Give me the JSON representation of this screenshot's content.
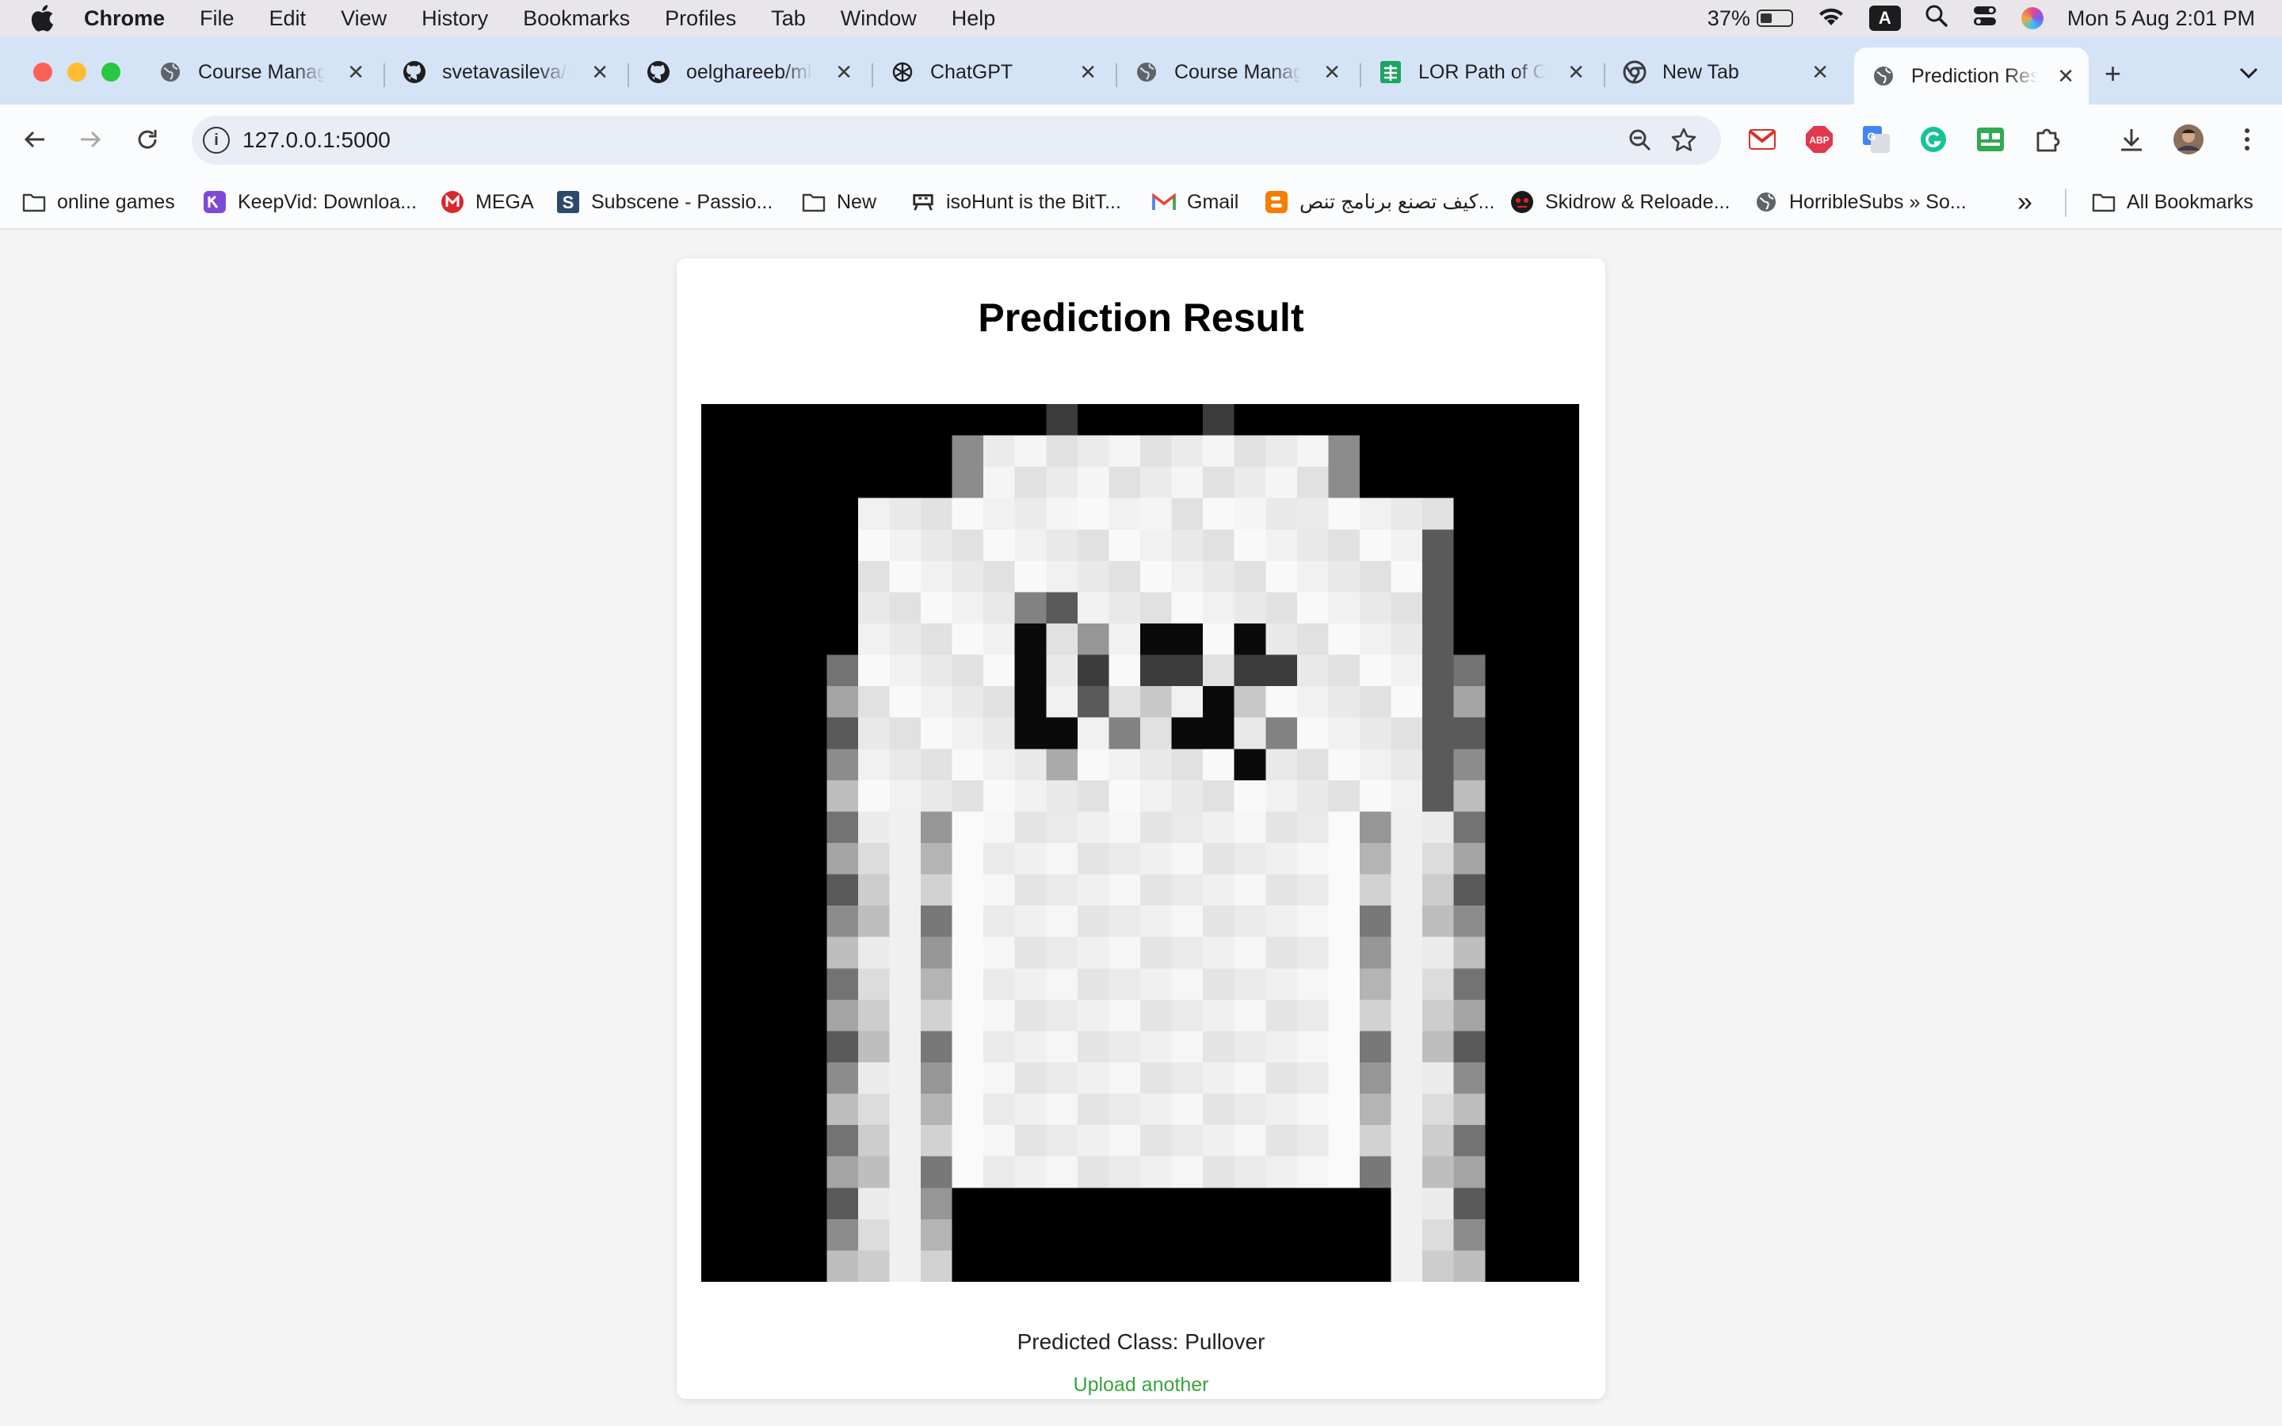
{
  "menubar": {
    "app_name": "Chrome",
    "items": [
      "File",
      "Edit",
      "View",
      "History",
      "Bookmarks",
      "Profiles",
      "Tab",
      "Window",
      "Help"
    ],
    "battery_percent": "37%",
    "battery_level": 0.37,
    "keyboard_input": "A",
    "datetime": "Mon 5 Aug  2:01 PM"
  },
  "tabs": [
    {
      "title": "Course Manag",
      "icon": "globe-icon"
    },
    {
      "title": "svetavasileva/c",
      "icon": "github-icon"
    },
    {
      "title": "oelghareeb/ml",
      "icon": "github-icon"
    },
    {
      "title": "ChatGPT",
      "icon": "chatgpt-icon"
    },
    {
      "title": "Course Manag",
      "icon": "globe-icon"
    },
    {
      "title": "LOR Path of Cl",
      "icon": "sheets-icon"
    },
    {
      "title": "New Tab",
      "icon": "chrome-icon"
    },
    {
      "title": "Prediction Res",
      "icon": "globe-icon",
      "active": true
    }
  ],
  "toolbar": {
    "url": "127.0.0.1:5000"
  },
  "bookmarks": {
    "items": [
      {
        "label": "online games",
        "icon": "folder-icon"
      },
      {
        "label": "KeepVid: Downloa...",
        "icon": "keepvid-icon"
      },
      {
        "label": "MEGA",
        "icon": "mega-icon"
      },
      {
        "label": "Subscene - Passio...",
        "icon": "subscene-icon"
      },
      {
        "label": "New",
        "icon": "folder-icon"
      },
      {
        "label": "isoHunt is the BitT...",
        "icon": "isohunt-icon"
      },
      {
        "label": "Gmail",
        "icon": "gmail-icon"
      },
      {
        "label": "كيف تصنع برنامج تنص...",
        "icon": "blogger-icon"
      },
      {
        "label": "Skidrow & Reloade...",
        "icon": "skidrow-icon"
      },
      {
        "label": "HorribleSubs » So...",
        "icon": "globe-icon"
      }
    ],
    "overflow_label": "»",
    "all_bookmarks": "All Bookmarks"
  },
  "page": {
    "heading": "Prediction Result",
    "image_alt": "Fashion-MNIST 28x28 grayscale input image",
    "predicted_label": "Predicted Class:",
    "predicted_class": "Pullover",
    "upload_link": "Upload another"
  },
  "colors": {
    "accent_link": "#38a33d",
    "tabstrip_bg": "#d5e3f7",
    "page_bg": "#f4f4f4"
  }
}
